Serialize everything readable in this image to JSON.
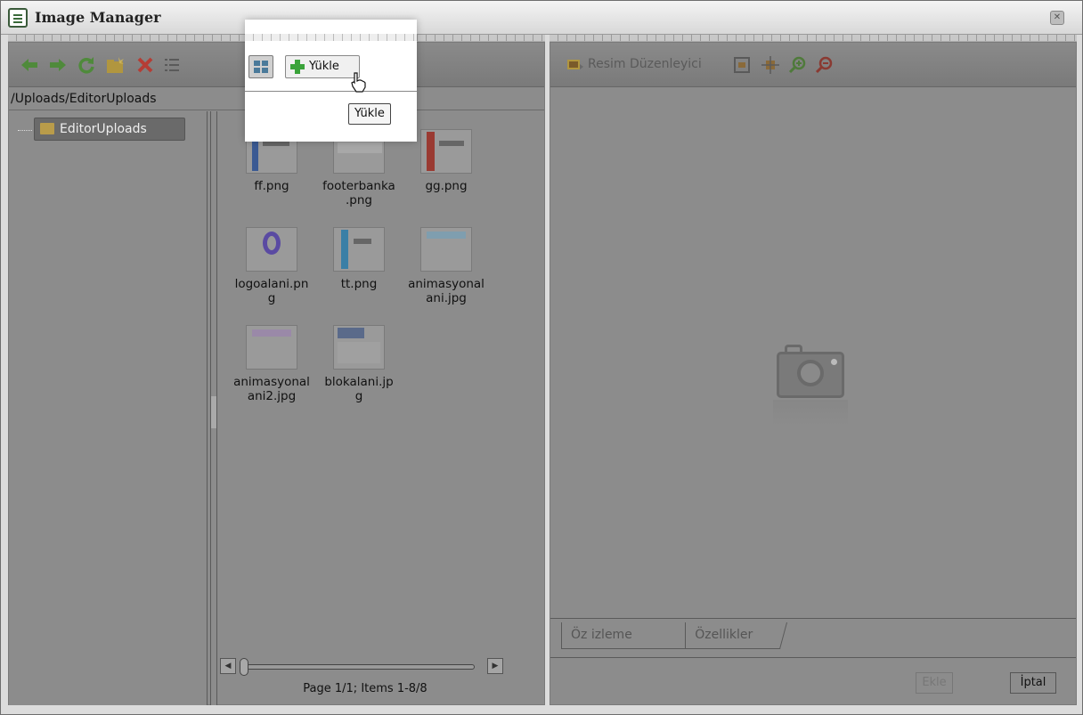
{
  "window": {
    "title": "Image Manager",
    "close_icon": "close-icon"
  },
  "left_toolbar": {
    "tools": [
      "back-arrow-icon",
      "forward-arrow-icon",
      "refresh-icon",
      "new-folder-icon",
      "delete-icon",
      "list-view-icon",
      "grid-view-icon"
    ],
    "upload_label": "Yükle"
  },
  "path": "/Uploads/EditorUploads",
  "tree": {
    "root_label": "EditorUploads"
  },
  "files": [
    {
      "name": "ff.png"
    },
    {
      "name": "footerbanka\n.png"
    },
    {
      "name": "gg.png"
    },
    {
      "name": "logoalani.pn\ng"
    },
    {
      "name": "tt.png"
    },
    {
      "name": "animasyonal\nani.jpg"
    },
    {
      "name": "animasyonal\nani2.jpg"
    },
    {
      "name": "blokalani.jp\ng"
    }
  ],
  "pager_text": "Page 1/1; Items 1-8/8",
  "right_toolbar": {
    "editor_label": "Resim Düzenleyici",
    "tools": [
      "fit-icon",
      "actual-size-icon",
      "zoom-in-icon",
      "zoom-out-icon"
    ]
  },
  "tabs": [
    "Öz izleme",
    "Özellikler"
  ],
  "buttons": {
    "insert": "Ekle",
    "cancel": "İptal"
  },
  "tooltip": "Yükle"
}
